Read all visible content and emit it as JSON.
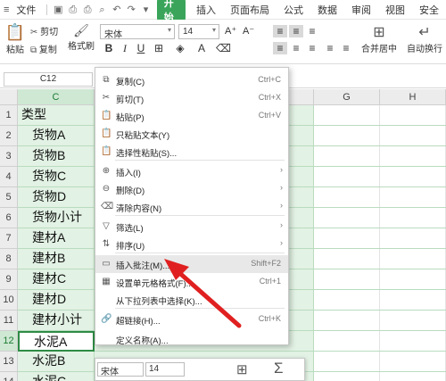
{
  "menubar": {
    "file": "文件",
    "start": "开始",
    "tabs": [
      "插入",
      "页面布局",
      "公式",
      "数据",
      "审阅",
      "视图",
      "安全"
    ]
  },
  "ribbon": {
    "paste": "粘贴",
    "cut": "剪切",
    "copy": "复制",
    "format_painter": "格式刷",
    "font_name": "宋体",
    "font_size": "14",
    "merge_center": "合并居中",
    "wrap_text": "自动换行"
  },
  "formula_bar": {
    "name_box": "C12"
  },
  "columns": {
    "c": "C",
    "g": "G",
    "h": "H"
  },
  "rows": [
    {
      "num": "1",
      "text": "类型",
      "indent": false
    },
    {
      "num": "2",
      "text": "货物A",
      "indent": true
    },
    {
      "num": "3",
      "text": "货物B",
      "indent": true
    },
    {
      "num": "4",
      "text": "货物C",
      "indent": true
    },
    {
      "num": "5",
      "text": "货物D",
      "indent": true
    },
    {
      "num": "6",
      "text": "货物小计",
      "indent": true
    },
    {
      "num": "7",
      "text": "建材A",
      "indent": true
    },
    {
      "num": "8",
      "text": "建材B",
      "indent": true
    },
    {
      "num": "9",
      "text": "建材C",
      "indent": true
    },
    {
      "num": "10",
      "text": "建材D",
      "indent": true
    },
    {
      "num": "11",
      "text": "建材小计",
      "indent": true
    },
    {
      "num": "12",
      "text": "水泥A",
      "indent": true
    },
    {
      "num": "13",
      "text": "水泥B",
      "indent": true
    },
    {
      "num": "14",
      "text": "水泥C",
      "indent": true
    }
  ],
  "context_menu": {
    "items": [
      {
        "label": "复制(C)",
        "shortcut": "Ctrl+C",
        "icon": "copy-icon"
      },
      {
        "label": "剪切(T)",
        "shortcut": "Ctrl+X",
        "icon": "scissors-icon"
      },
      {
        "label": "粘贴(P)",
        "shortcut": "Ctrl+V",
        "icon": "paste-icon"
      },
      {
        "label": "只粘贴文本(Y)",
        "shortcut": "",
        "icon": "paste-text-icon"
      },
      {
        "label": "选择性粘贴(S)...",
        "shortcut": "",
        "icon": "paste-special-icon"
      },
      {
        "label": "插入(I)",
        "shortcut": "",
        "icon": "insert-icon"
      },
      {
        "label": "删除(D)",
        "shortcut": "",
        "icon": "delete-icon"
      },
      {
        "label": "清除内容(N)",
        "shortcut": "",
        "icon": "eraser-icon"
      },
      {
        "label": "筛选(L)",
        "shortcut": "",
        "icon": "filter-icon"
      },
      {
        "label": "排序(U)",
        "shortcut": "",
        "icon": "sort-icon"
      },
      {
        "label": "插入批注(M)...",
        "shortcut": "Shift+F2",
        "icon": "comment-icon"
      },
      {
        "label": "设置单元格格式(F)...",
        "shortcut": "Ctrl+1",
        "icon": "format-cells-icon"
      },
      {
        "label": "从下拉列表中选择(K)...",
        "shortcut": "",
        "icon": ""
      },
      {
        "label": "超链接(H)...",
        "shortcut": "Ctrl+K",
        "icon": "link-icon"
      },
      {
        "label": "定义名称(A)...",
        "shortcut": "",
        "icon": ""
      }
    ]
  },
  "mini_toolbar": {
    "font_name": "宋体",
    "font_size": "14"
  },
  "colors": {
    "accent": "#3aa55a",
    "cell_fill": "#e2f2e4",
    "arrow": "#e02020"
  }
}
